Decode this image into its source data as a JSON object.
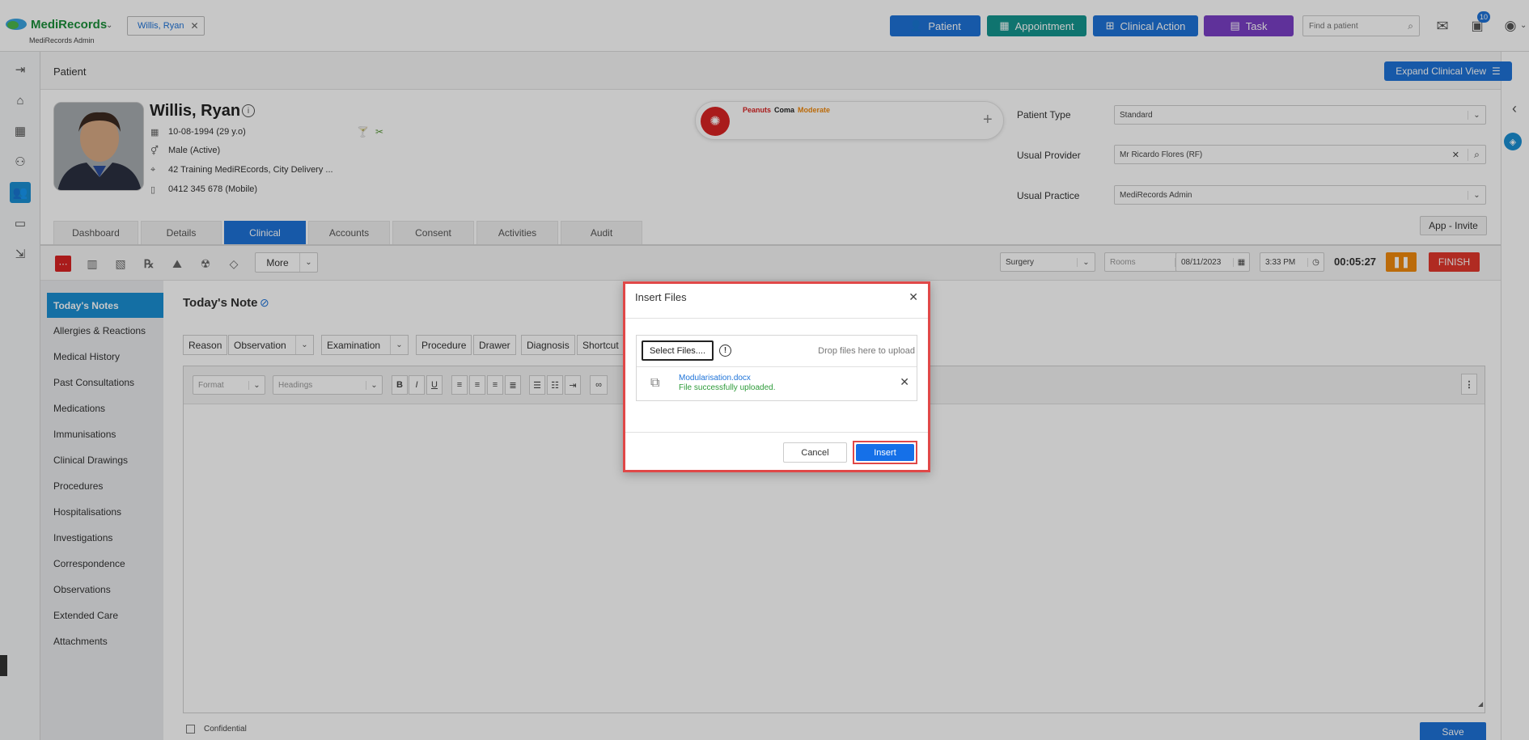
{
  "app": {
    "name": "MediRecords",
    "org": "MediRecords Admin",
    "open_tab": "Willis, Ryan"
  },
  "header_buttons": {
    "patient": "Patient",
    "appointment": "Appointment",
    "clinical_action": "Clinical Action",
    "task": "Task"
  },
  "search": {
    "placeholder": "Find a patient"
  },
  "notifications": {
    "count": "10"
  },
  "page": {
    "title": "Patient",
    "expand_label": "Expand Clinical View"
  },
  "patient": {
    "name": "Willis, Ryan",
    "dob": "10-08-1994 (29 y.o)",
    "gender": "Male (Active)",
    "address": "42 Training MediREcords, City Delivery ...",
    "phone": "0412 345 678 (Mobile)"
  },
  "allergy": {
    "substance": "Peanuts",
    "reaction": "Coma",
    "severity": "Moderate"
  },
  "details": {
    "patient_type_label": "Patient Type",
    "patient_type_value": "Standard",
    "provider_label": "Usual Provider",
    "provider_value": "Mr Ricardo Flores (RF)",
    "practice_label": "Usual Practice",
    "practice_value": "MediRecords Admin",
    "app_invite": "App - Invite"
  },
  "tabs": [
    "Dashboard",
    "Details",
    "Clinical",
    "Accounts",
    "Consent",
    "Activities",
    "Audit"
  ],
  "toolbar": {
    "more": "More",
    "location": "Surgery",
    "rooms": "Rooms",
    "date": "08/11/2023",
    "time": "3:33 PM",
    "timer": "00:05:27",
    "finish": "FINISH"
  },
  "nav": [
    "Today's Notes",
    "Allergies & Reactions",
    "Medical History",
    "Past Consultations",
    "Medications",
    "Immunisations",
    "Clinical Drawings",
    "Procedures",
    "Hospitalisations",
    "Investigations",
    "Correspondence",
    "Observations",
    "Extended Care",
    "Attachments"
  ],
  "note": {
    "title": "Today's Note",
    "chips": [
      "Reason",
      "Observation",
      "Examination",
      "Procedure",
      "Drawer",
      "Diagnosis",
      "Shortcut"
    ],
    "format_placeholder": "Format",
    "headings_placeholder": "Headings",
    "confidential": "Confidential",
    "save": "Save"
  },
  "modal": {
    "title": "Insert Files",
    "select_button": "Select Files....",
    "drop_hint": "Drop files here to upload",
    "file_name": "Modularisation.docx",
    "file_status": "File successfully uploaded.",
    "cancel": "Cancel",
    "insert": "Insert"
  },
  "colors": {
    "primary": "#1e73d8",
    "teal": "#14958f",
    "purple": "#7a3fc6",
    "sidebar_active": "#1a8fd3",
    "modal_border": "#e04848",
    "orange": "#f0890e",
    "finish": "#e2382c"
  }
}
